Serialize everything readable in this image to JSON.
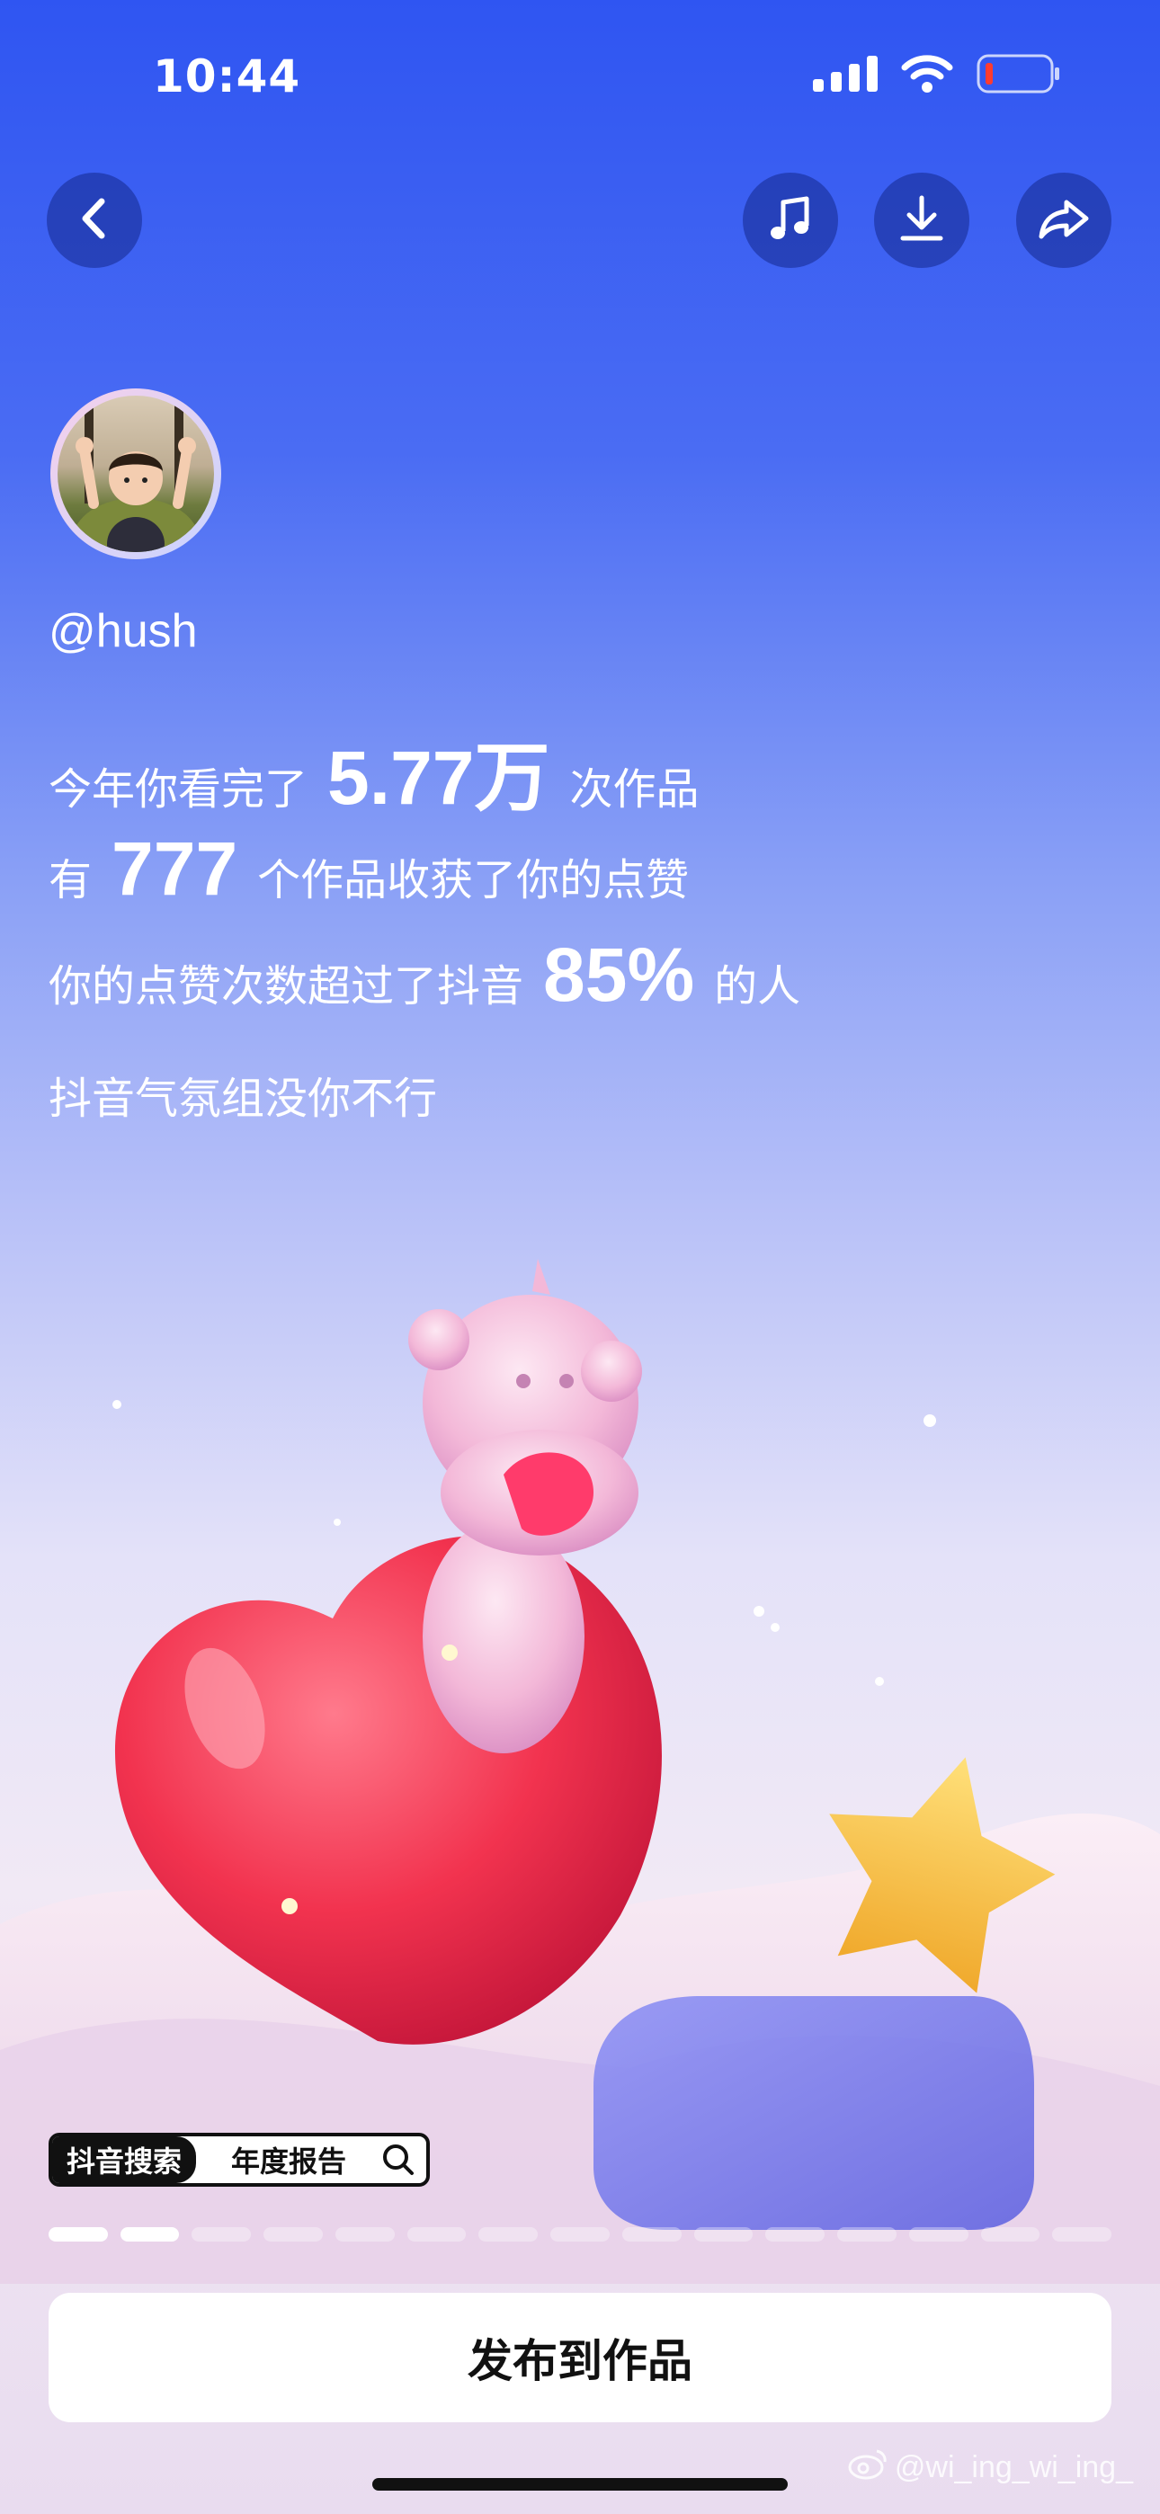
{
  "status_bar": {
    "time": "10:44",
    "icons": [
      "signal-icon",
      "wifi-icon",
      "battery-icon"
    ]
  },
  "toolbar": {
    "icons": [
      "back-icon",
      "music-icon",
      "download-icon",
      "share-icon"
    ]
  },
  "profile": {
    "username": "@hush"
  },
  "stats": {
    "line1": {
      "pre": "今年你看完了",
      "value": "5.77万",
      "post": "次作品"
    },
    "line2": {
      "pre": "有",
      "value": "777",
      "post": "个作品收获了你的点赞"
    },
    "line3": {
      "pre": "你的点赞次数超过了抖音",
      "value": "85%",
      "post": "的人"
    },
    "line4": {
      "text": "抖音气氛组没你不行"
    }
  },
  "search_tag": {
    "brand": "抖音搜索",
    "query": "年度报告",
    "icon": "search-icon"
  },
  "progress": {
    "total": 15,
    "completed": 2
  },
  "publish_button": {
    "label": "发布到作品"
  },
  "watermark": {
    "text": "@wi_ing_wi_ing_"
  },
  "colors": {
    "accent_top": "#2f55f2",
    "heart": "#f2334f",
    "star": "#f7c23a"
  }
}
